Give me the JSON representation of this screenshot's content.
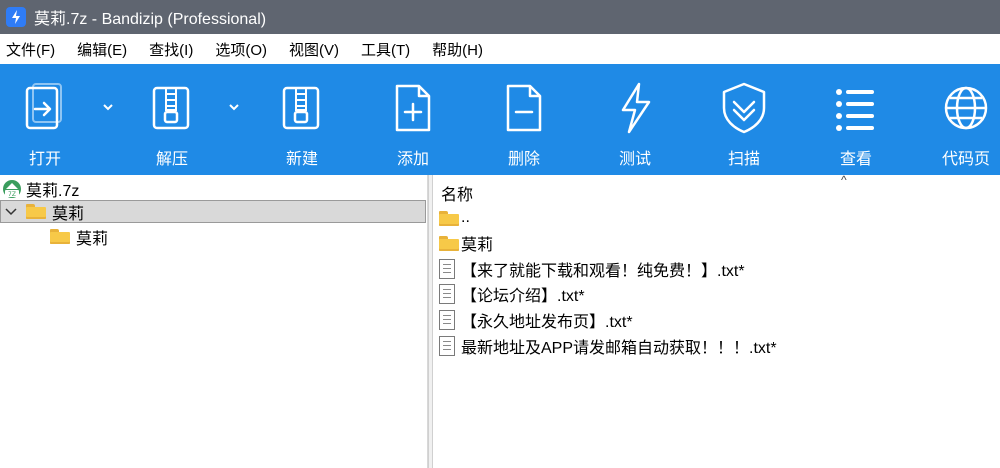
{
  "window": {
    "title": "莫莉.7z - Bandizip (Professional)"
  },
  "menu": [
    "文件(F)",
    "编辑(E)",
    "查找(I)",
    "选项(O)",
    "视图(V)",
    "工具(T)",
    "帮助(H)"
  ],
  "toolbar": {
    "buttons": [
      {
        "label": "打开",
        "icon": "open-icon",
        "has_dropdown": true
      },
      {
        "label": "解压",
        "icon": "extract-icon",
        "has_dropdown": true
      },
      {
        "label": "新建",
        "icon": "new-archive-icon",
        "has_dropdown": false
      },
      {
        "label": "添加",
        "icon": "add-file-icon",
        "has_dropdown": false
      },
      {
        "label": "删除",
        "icon": "delete-file-icon",
        "has_dropdown": false
      },
      {
        "label": "测试",
        "icon": "test-icon",
        "has_dropdown": false
      },
      {
        "label": "扫描",
        "icon": "scan-shield-icon",
        "has_dropdown": false
      },
      {
        "label": "查看",
        "icon": "view-list-icon",
        "has_dropdown": false
      },
      {
        "label": "代码页",
        "icon": "globe-icon",
        "has_dropdown": false
      }
    ],
    "bg_color": "#1f8ae6"
  },
  "tree": {
    "archive": "莫莉.7z",
    "folder": "莫莉",
    "subfolder": "莫莉"
  },
  "file_list": {
    "column_name": "名称",
    "parent": "..",
    "folder": "莫莉",
    "files": [
      "【来了就能下载和观看！纯免费！】.txt*",
      "【论坛介绍】.txt*",
      "【永久地址发布页】.txt*",
      "最新地址及APP请发邮箱自动获取！！！.txt*"
    ]
  }
}
